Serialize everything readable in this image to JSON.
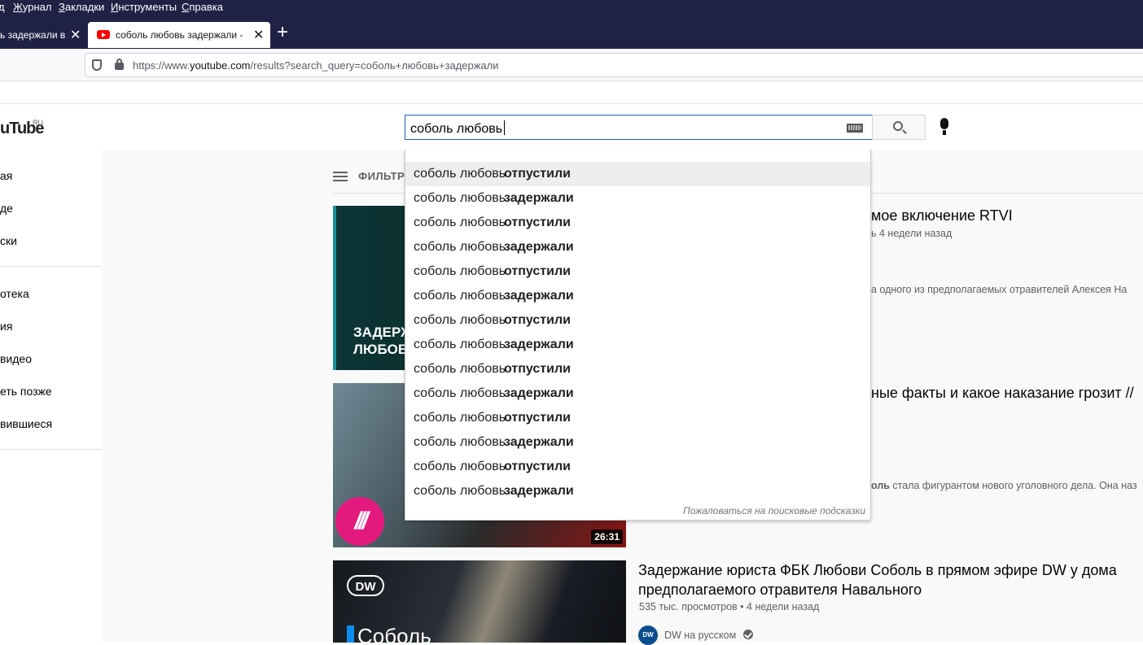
{
  "browser": {
    "menu": [
      "д",
      "Журнал",
      "Закладки",
      "Инструменты",
      "Справка"
    ],
    "tabs": [
      {
        "label": "ь задержали в",
        "active": false
      },
      {
        "label": "соболь любовь задержали - Y",
        "active": true
      }
    ],
    "new_tab": "+",
    "close_glyph": "✕",
    "url_prefix": "https://www.",
    "url_domain": "youtube.com",
    "url_path": "/results?search_query=соболь+любовь+задержали"
  },
  "youtube": {
    "logo": "uTube",
    "logo_region": "RU",
    "search_value": "соболь любовь",
    "sidebar": [
      "ая",
      "де",
      "ски",
      "отека",
      "ия",
      "видео",
      "еть позже",
      "вившиеся"
    ],
    "filter_label": "ФИЛЬТР",
    "suggestions": [
      {
        "query": "соболь любовь",
        "completion": "отпустили",
        "selected": true
      },
      {
        "query": "соболь любовь",
        "completion": "задержали",
        "selected": false
      },
      {
        "query": "соболь любовь",
        "completion": "отпустили",
        "selected": false
      },
      {
        "query": "соболь любовь",
        "completion": "задержали",
        "selected": false
      },
      {
        "query": "соболь любовь",
        "completion": "отпустили",
        "selected": false
      },
      {
        "query": "соболь любовь",
        "completion": "задержали",
        "selected": false
      },
      {
        "query": "соболь любовь",
        "completion": "отпустили",
        "selected": false
      },
      {
        "query": "соболь любовь",
        "completion": "задержали",
        "selected": false
      },
      {
        "query": "соболь любовь",
        "completion": "отпустили",
        "selected": false
      },
      {
        "query": "соболь любовь",
        "completion": "задержали",
        "selected": false
      },
      {
        "query": "соболь любовь",
        "completion": "отпустили",
        "selected": false
      },
      {
        "query": "соболь любовь",
        "completion": "задержали",
        "selected": false
      },
      {
        "query": "соболь любовь",
        "completion": "отпустили",
        "selected": false
      },
      {
        "query": "соболь любовь",
        "completion": "задержали",
        "selected": false
      }
    ],
    "report_link": "Пожаловаться на поисковые подсказки",
    "videos": [
      {
        "title_partial": "мое включение RTVI",
        "meta_partial": "ь 4 недели назад",
        "desc_partial": "а одного из предполагаемых отравителей Алексея На",
        "thumb_text_line1": "ЗАДЕРЖ",
        "thumb_text_line2": "ЛЮБОВ"
      },
      {
        "title_partial": "ные факты и какое наказание грозит //",
        "desc_bold": "оль",
        "desc_partial": " стала фигурантом нового уголовного дела. Она наз",
        "duration": "26:31",
        "channel_logo": "///"
      },
      {
        "title_line1": "Задержание юриста ФБК Любови Соболь в прямом эфире DW у дома",
        "title_line2": "предполагаемого отравителя Навального",
        "meta": "535 тыс. просмотров • 4 недели назад",
        "channel": "DW на русском",
        "channel_logo": "DW",
        "thumb_text": "Соболь"
      }
    ]
  }
}
